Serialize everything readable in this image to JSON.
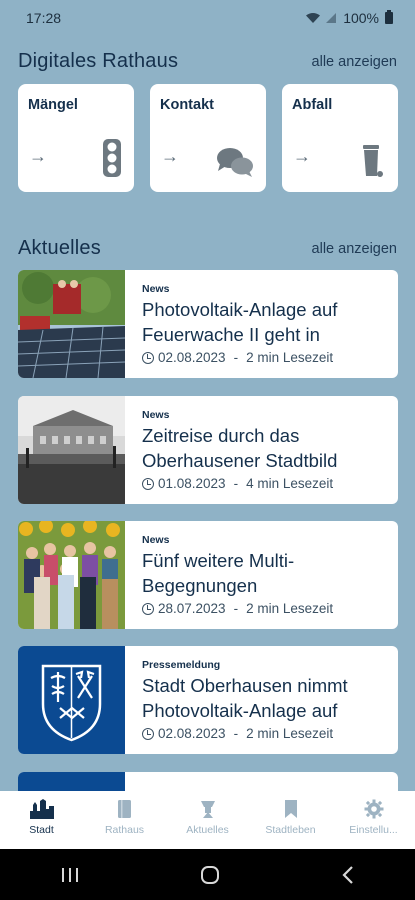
{
  "status": {
    "time": "17:28",
    "battery": "100%"
  },
  "sections": {
    "digital": {
      "title": "Digitales Rathaus",
      "show_all": "alle anzeigen"
    },
    "news": {
      "title": "Aktuelles",
      "show_all": "alle anzeigen"
    }
  },
  "tiles": [
    {
      "label": "Mängel",
      "icon": "traffic-light-icon"
    },
    {
      "label": "Kontakt",
      "icon": "chat-bubbles-icon"
    },
    {
      "label": "Abfall",
      "icon": "trash-bin-icon"
    }
  ],
  "news": [
    {
      "category": "News",
      "title": "Photovoltaik-Anlage auf Feuerwache II geht in",
      "date": "02.08.2023",
      "read_time": "2 min Lesezeit"
    },
    {
      "category": "News",
      "title": "Zeitreise durch das Oberhausener Stadtbild",
      "date": "01.08.2023",
      "read_time": "4 min Lesezeit"
    },
    {
      "category": "News",
      "title": "Fünf weitere Multi-Begegnungen",
      "date": "28.07.2023",
      "read_time": "2 min Lesezeit"
    },
    {
      "category": "Pressemeldung",
      "title": "Stadt Oberhausen nimmt Photovoltaik-Anlage auf",
      "date": "02.08.2023",
      "read_time": "2 min Lesezeit"
    }
  ],
  "meta_separator": "-",
  "bottom_nav": [
    {
      "label": "Stadt",
      "icon": "city-icon",
      "active": true
    },
    {
      "label": "Rathaus",
      "icon": "book-icon",
      "active": false
    },
    {
      "label": "Aktuelles",
      "icon": "megaphone-icon",
      "active": false
    },
    {
      "label": "Stadtleben",
      "icon": "bookmark-icon",
      "active": false
    },
    {
      "label": "Einstellu...",
      "icon": "gear-icon",
      "active": false
    }
  ],
  "colors": {
    "background": "#8fb2c6",
    "text_dark": "#15304c",
    "nav_inactive": "#9eb3c2",
    "crest_blue": "#0b4a92"
  }
}
